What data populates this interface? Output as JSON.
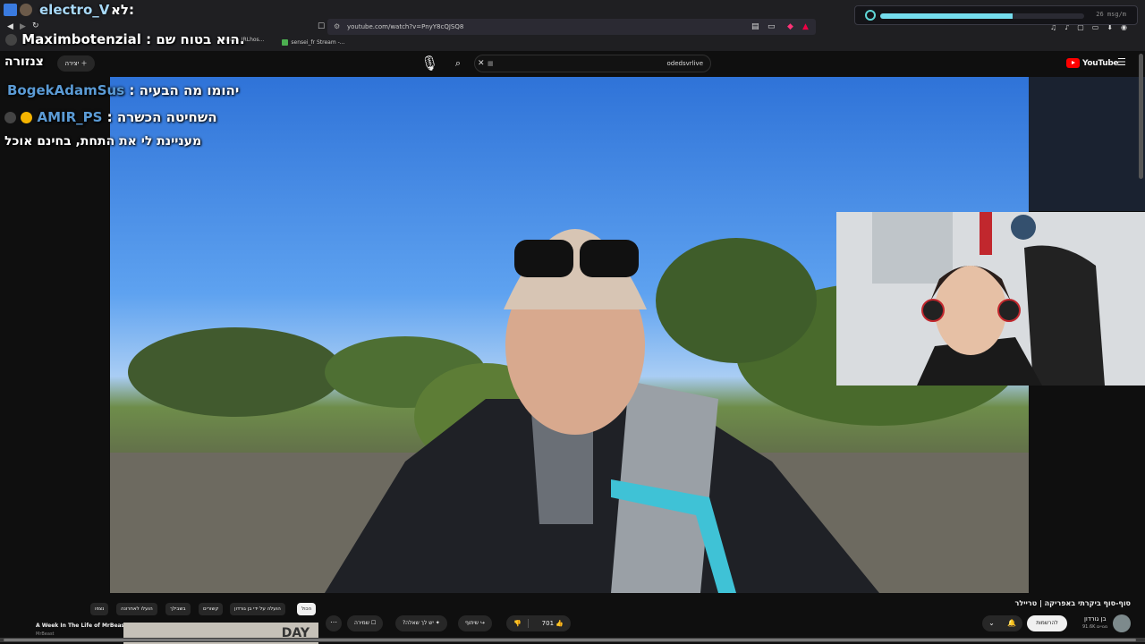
{
  "browser": {
    "url": "youtube.com/watch?v=PnyY8cQJSQ8",
    "tabs": [
      {
        "label": "Area - IRLhos..."
      },
      {
        "label": "sensei_fr Stream -..."
      }
    ]
  },
  "stream_widget": {
    "progress": 0.65,
    "msg_rate": "26 msg/m",
    "accent_color": "#74dced"
  },
  "stream_overlay": {
    "streamer_name": "electro_V",
    "streamer_prefix": "לא:",
    "chat": [
      {
        "user": "Maximbotenzial",
        "text": "הוא בטוח שם.",
        "user_color": "#ffffff"
      },
      {
        "user": "",
        "text": "צנזורה"
      },
      {
        "user": "BogekAdamSus",
        "text": "יהומו מה הבעיה",
        "user_color": "#5b9bd5"
      },
      {
        "user": "AMIR_PS",
        "text": "השחיטה הכשרה",
        "user_color": "#5b9bd5"
      },
      {
        "user": "",
        "text": "מעניינת לי את התחת, בחינם אוכל"
      }
    ]
  },
  "youtube": {
    "create_label": "יצירה",
    "search_query": "odedsvrlive",
    "logo_text": "YouTube",
    "logo_icon": "youtube-logo-icon",
    "brand_color": "#ff0000"
  },
  "video": {
    "title": "סוף-סוף ביקרתי באפריקה | טריילר",
    "channel": {
      "name": "בן גורדון",
      "subscribers": "91.6K מנויים"
    },
    "subscribe_label": "להרשמות",
    "likes": "701",
    "share_label": "שיתוף",
    "ask_label": "יש לך שאלה?",
    "save_label": "שמירה"
  },
  "chips": [
    {
      "label": "הכול",
      "active": true
    },
    {
      "label": "הועלה על ידי בן גורדון",
      "active": false
    },
    {
      "label": "קשורים",
      "active": false
    },
    {
      "label": "בשבילך",
      "active": false
    },
    {
      "label": "הועלו לאחרונה",
      "active": false
    },
    {
      "label": "נצפו",
      "active": false
    }
  ],
  "recommendation": {
    "title": "A Week In The Life of MrBeast",
    "channel": "MrBeast",
    "thumb_text": "DAY"
  }
}
